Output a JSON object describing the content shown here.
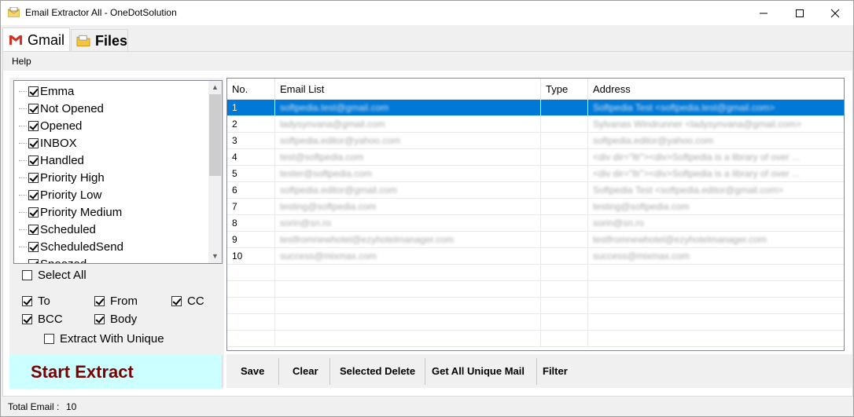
{
  "window": {
    "title": "Email Extractor All - OneDotSolution"
  },
  "tabs": [
    {
      "label": "Gmail",
      "icon": "gmail-icon",
      "active": true
    },
    {
      "label": "Files",
      "icon": "folder-icon",
      "active": false
    }
  ],
  "menu": {
    "help": "Help"
  },
  "folders": [
    {
      "label": "Emma",
      "checked": true
    },
    {
      "label": "Not Opened",
      "checked": true
    },
    {
      "label": "Opened",
      "checked": true
    },
    {
      "label": "INBOX",
      "checked": true
    },
    {
      "label": "Handled",
      "checked": true
    },
    {
      "label": "Priority High",
      "checked": true
    },
    {
      "label": "Priority Low",
      "checked": true
    },
    {
      "label": "Priority Medium",
      "checked": true
    },
    {
      "label": "Scheduled",
      "checked": true
    },
    {
      "label": "ScheduledSend",
      "checked": true
    },
    {
      "label": "Snoozed",
      "checked": true
    }
  ],
  "options": {
    "select_all": {
      "label": "Select All",
      "checked": false
    },
    "to": {
      "label": "To",
      "checked": true
    },
    "from": {
      "label": "From",
      "checked": true
    },
    "cc": {
      "label": "CC",
      "checked": true
    },
    "bcc": {
      "label": "BCC",
      "checked": true
    },
    "body": {
      "label": "Body",
      "checked": true
    },
    "unique": {
      "label": "Extract With Unique",
      "checked": false
    }
  },
  "start_button": "Start Extract",
  "grid": {
    "columns": [
      "No.",
      "Email List",
      "Type",
      "Address"
    ],
    "rows": [
      {
        "no": "1",
        "email": "softpedia.test@gmail.com",
        "type": "",
        "address": "Softpedia Test <softpedia.test@gmail.com>"
      },
      {
        "no": "2",
        "email": "ladysynvana@gmail.com",
        "type": "",
        "address": "Sylvanas Windrunner <ladysynvana@gmail.com>"
      },
      {
        "no": "3",
        "email": "softpedia.editor@yahoo.com",
        "type": "",
        "address": "softpedia.editor@yahoo.com"
      },
      {
        "no": "4",
        "email": "test@softpedia.com",
        "type": "",
        "address": "<div dir=\"ltr\"><div>Softpedia is a library of over ..."
      },
      {
        "no": "5",
        "email": "tester@softpedia.com",
        "type": "",
        "address": "<div dir=\"ltr\"><div>Softpedia is a library of over ..."
      },
      {
        "no": "6",
        "email": "softpedia.editor@gmail.com",
        "type": "",
        "address": "Softpedia Test <softpedia.editor@gmail.com>"
      },
      {
        "no": "7",
        "email": "testing@softpedia.com",
        "type": "",
        "address": "testing@softpedia.com"
      },
      {
        "no": "8",
        "email": "sorin@sn.ro",
        "type": "",
        "address": "sorin@sn.ro"
      },
      {
        "no": "9",
        "email": "testfromnewhotel@ezyhotelmanager.com",
        "type": "",
        "address": "testfromnewhotel@ezyhotelmanager.com"
      },
      {
        "no": "10",
        "email": "success@mixmax.com",
        "type": "",
        "address": "success@mixmax.com"
      }
    ]
  },
  "toolbar": {
    "save": "Save",
    "clear": "Clear",
    "selected_delete": "Selected Delete",
    "get_unique": "Get All Unique Mail",
    "filter": "Filter"
  },
  "status": {
    "label": "Total Email :",
    "value": "10"
  },
  "colors": {
    "accent": "#0078d7",
    "start_bg": "#ccffff",
    "start_fg": "#7b0000"
  }
}
